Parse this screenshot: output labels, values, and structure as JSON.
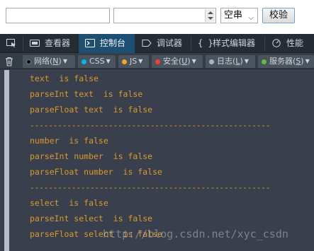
{
  "form": {
    "text_value": "",
    "number_value": "",
    "select_value": "空串",
    "button_label": "校验"
  },
  "devtools": {
    "tabs": [
      {
        "label": "查看器",
        "icon": "inspector-icon"
      },
      {
        "label": "控制台",
        "icon": "console-icon",
        "active": true
      },
      {
        "label": "调试器",
        "icon": "debugger-icon"
      },
      {
        "label": "样式编辑器",
        "icon": "style-editor-icon",
        "icon_text": "{ }"
      },
      {
        "label": "性能",
        "icon": "performance-icon"
      }
    ],
    "filters": [
      {
        "label": "网络",
        "key": "N",
        "color": "#000000"
      },
      {
        "label": "CSS",
        "key": "",
        "color": "#00b6f0"
      },
      {
        "label": "JS",
        "key": "",
        "color": "#f5a623"
      },
      {
        "label": "安全",
        "key": "U",
        "color": "#ff3b30"
      },
      {
        "label": "日志",
        "key": "L",
        "color": "#b0b6bd"
      },
      {
        "label": "服务器",
        "key": "S",
        "color": "#5fbf3a"
      }
    ],
    "console_lines": [
      "text  is false",
      "parseInt text  is false",
      "parseFloat text  is false",
      "----------------------------------------------------",
      "number  is false",
      "parseInt number  is false",
      "parseFloat number  is false",
      "----------------------------------------------------",
      "select  is false",
      "parseInt select  is false",
      "parseFloat select  is false"
    ]
  },
  "watermark": "http://blog.csdn.net/xyc_csdn"
}
